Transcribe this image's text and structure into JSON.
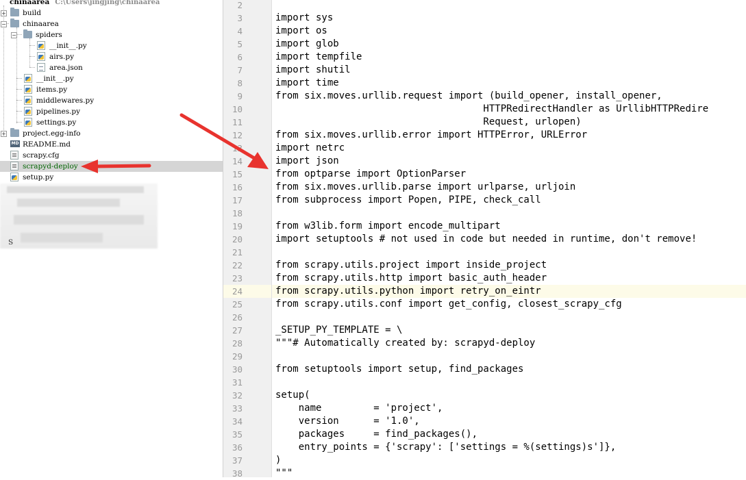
{
  "tree": {
    "root": {
      "label": "chinaarea",
      "path": "C:\\Users\\jingjing\\chinaarea"
    },
    "items": [
      {
        "label": "build",
        "type": "folder",
        "expander": "+"
      },
      {
        "label": "chinaarea",
        "type": "folder",
        "expander": "−"
      },
      {
        "label": "spiders",
        "type": "folder",
        "expander": "−"
      },
      {
        "label": "__init__.py",
        "type": "py"
      },
      {
        "label": "airs.py",
        "type": "py"
      },
      {
        "label": "area.json",
        "type": "json"
      },
      {
        "label": "__init__.py",
        "type": "py"
      },
      {
        "label": "items.py",
        "type": "py"
      },
      {
        "label": "middlewares.py",
        "type": "py"
      },
      {
        "label": "pipelines.py",
        "type": "py"
      },
      {
        "label": "settings.py",
        "type": "py"
      },
      {
        "label": "project.egg-info",
        "type": "folder",
        "expander": "+"
      },
      {
        "label": "README.md",
        "type": "md"
      },
      {
        "label": "scrapy.cfg",
        "type": "cfg"
      },
      {
        "label": "scrapyd-deploy",
        "type": "cfg"
      },
      {
        "label": "setup.py",
        "type": "py"
      }
    ],
    "md_badge": "MD",
    "selected_index": 14,
    "obscured_tail": "S"
  },
  "editor": {
    "current_line": 24,
    "lines": [
      {
        "n": "2",
        "t": ""
      },
      {
        "n": "3",
        "t": "import sys"
      },
      {
        "n": "4",
        "t": "import os"
      },
      {
        "n": "5",
        "t": "import glob"
      },
      {
        "n": "6",
        "t": "import tempfile"
      },
      {
        "n": "7",
        "t": "import shutil"
      },
      {
        "n": "8",
        "t": "import time"
      },
      {
        "n": "9",
        "t": "from six.moves.urllib.request import (build_opener, install_opener,"
      },
      {
        "n": "10",
        "t": "                                    HTTPRedirectHandler as UrllibHTTPRedire"
      },
      {
        "n": "11",
        "t": "                                    Request, urlopen)"
      },
      {
        "n": "12",
        "t": "from six.moves.urllib.error import HTTPError, URLError"
      },
      {
        "n": "13",
        "t": "import netrc"
      },
      {
        "n": "14",
        "t": "import json"
      },
      {
        "n": "15",
        "t": "from optparse import OptionParser"
      },
      {
        "n": "16",
        "t": "from six.moves.urllib.parse import urlparse, urljoin"
      },
      {
        "n": "17",
        "t": "from subprocess import Popen, PIPE, check_call"
      },
      {
        "n": "18",
        "t": ""
      },
      {
        "n": "19",
        "t": "from w3lib.form import encode_multipart"
      },
      {
        "n": "20",
        "t": "import setuptools # not used in code but needed in runtime, don't remove!"
      },
      {
        "n": "21",
        "t": ""
      },
      {
        "n": "22",
        "t": "from scrapy.utils.project import inside_project"
      },
      {
        "n": "23",
        "t": "from scrapy.utils.http import basic_auth_header"
      },
      {
        "n": "24",
        "t": "from scrapy.utils.python import retry_on_eintr"
      },
      {
        "n": "25",
        "t": "from scrapy.utils.conf import get_config, closest_scrapy_cfg"
      },
      {
        "n": "26",
        "t": ""
      },
      {
        "n": "27",
        "t": "_SETUP_PY_TEMPLATE = \\"
      },
      {
        "n": "28",
        "t": "\"\"\"# Automatically created by: scrapyd-deploy"
      },
      {
        "n": "29",
        "t": ""
      },
      {
        "n": "30",
        "t": "from setuptools import setup, find_packages"
      },
      {
        "n": "31",
        "t": ""
      },
      {
        "n": "32",
        "t": "setup("
      },
      {
        "n": "33",
        "t": "    name         = 'project',"
      },
      {
        "n": "34",
        "t": "    version      = '1.0',"
      },
      {
        "n": "35",
        "t": "    packages     = find_packages(),"
      },
      {
        "n": "36",
        "t": "    entry_points = {'scrapy': ['settings = %(settings)s']},"
      },
      {
        "n": "37",
        "t": ")"
      },
      {
        "n": "38",
        "t": "\"\"\""
      }
    ]
  },
  "colors": {
    "arrow": "#e8332e",
    "selected_text": "#006400",
    "current_line_bg": "#fdfbe8"
  }
}
